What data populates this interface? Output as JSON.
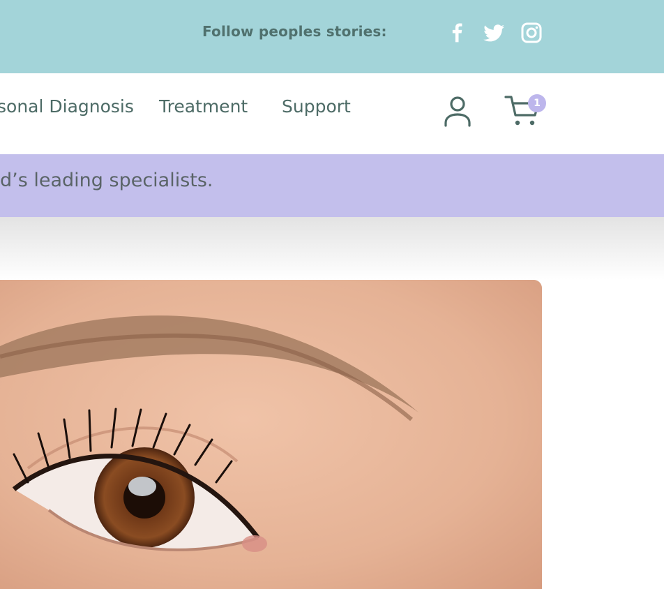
{
  "social_bar": {
    "follow_label": "Follow peoples stories:",
    "icons": [
      "facebook-icon",
      "twitter-icon",
      "instagram-icon"
    ]
  },
  "nav": {
    "items": [
      "sonal Diagnosis",
      "Treatment",
      "Support"
    ],
    "user_icon": "user-icon",
    "cart_icon": "cart-icon",
    "cart_count": "1"
  },
  "promo": {
    "text": "d’s leading specialists."
  },
  "hero": {
    "image": "close-up-brown-eye-photo"
  },
  "colors": {
    "top_bar": "#a3d4d9",
    "nav_text": "#4d6b66",
    "promo_banner": "#c3bfec",
    "cart_badge": "#bdb6ec",
    "skin": "#e7b79d"
  }
}
